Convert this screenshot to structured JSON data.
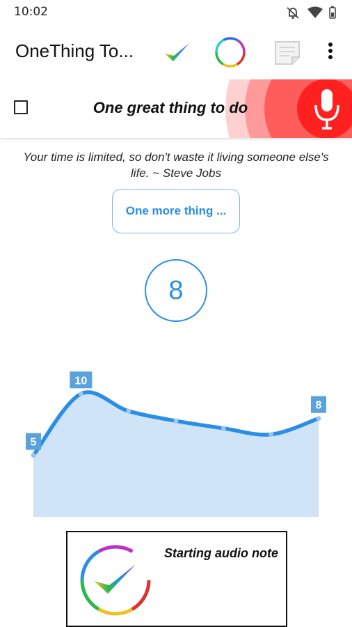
{
  "status_bar": {
    "time": "10:02",
    "icons": [
      "notifications-off-icon",
      "wifi-icon",
      "battery-icon"
    ]
  },
  "app_bar": {
    "title": "OneThing To...",
    "actions": [
      "check-logo-icon",
      "rainbow-circle-icon",
      "note-icon",
      "more-vert-icon"
    ]
  },
  "task": {
    "checked": false,
    "text": "One great thing to do",
    "mic_icon": "microphone-icon"
  },
  "quote": "Your time is limited, so don't waste it living someone else's life. ~ Steve Jobs",
  "more_button": {
    "label": "One more thing ..."
  },
  "count": "8",
  "chart_data": {
    "type": "area",
    "x": [
      1,
      2,
      3,
      4,
      5,
      6,
      7
    ],
    "values": [
      5,
      10,
      8.6,
      7.8,
      7.2,
      6.7,
      8
    ],
    "data_labels": [
      "5",
      "10",
      "",
      "",
      "",
      "",
      "8"
    ],
    "ylim": [
      0,
      12
    ],
    "grid": false,
    "colors": {
      "line": "#2a8ee6",
      "fill": "#cfe5f7",
      "label_bg": "#5aa2dc"
    }
  },
  "note": {
    "title": "Starting audio note"
  },
  "colors": {
    "accent": "#2a8ee6",
    "mic_red": "#ff2020"
  }
}
